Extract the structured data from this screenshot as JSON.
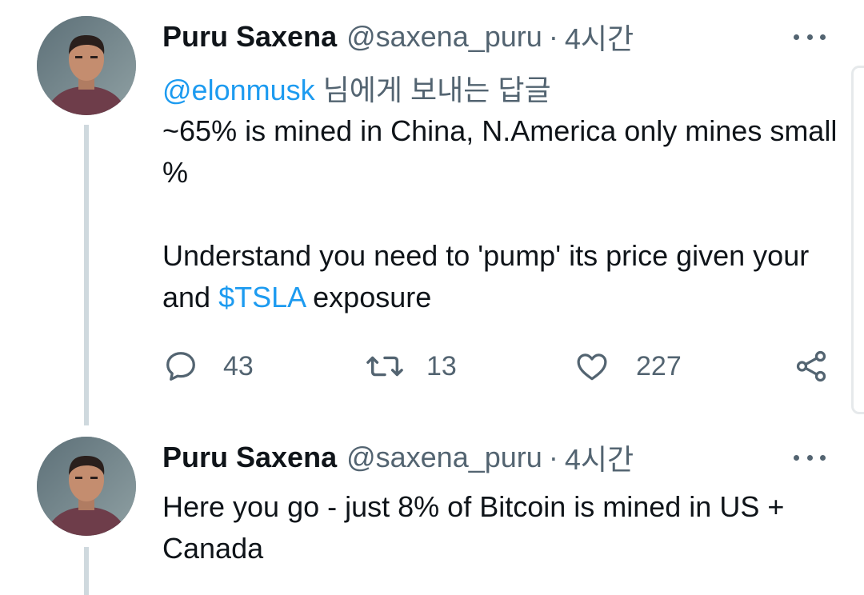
{
  "tweets": [
    {
      "author_name": "Puru Saxena",
      "handle": "@saxena_puru",
      "separator": "·",
      "time": "4시간",
      "reply_to_handle": "@elonmusk",
      "reply_to_suffix": " 님에게 보내는 답글",
      "body_line1": "~65% is mined in China, N.America only mines small %",
      "body_line2_prefix": "Understand you need to 'pump' its price given your and ",
      "body_line2_link": "$TSLA",
      "body_line2_suffix": " exposure",
      "reply_count": "43",
      "retweet_count": "13",
      "like_count": "227"
    },
    {
      "author_name": "Puru Saxena",
      "handle": "@saxena_puru",
      "separator": "·",
      "time": "4시간",
      "body": "Here you go - just 8% of Bitcoin is mined in US + Canada"
    }
  ],
  "icons": {
    "reply": "comment-icon",
    "retweet": "retweet-icon",
    "like": "heart-icon",
    "share": "share-icon",
    "more": "more-options-icon"
  },
  "colors": {
    "link": "#1d9bf0",
    "secondary_text": "#536471",
    "thread_line": "#cfd9de"
  }
}
